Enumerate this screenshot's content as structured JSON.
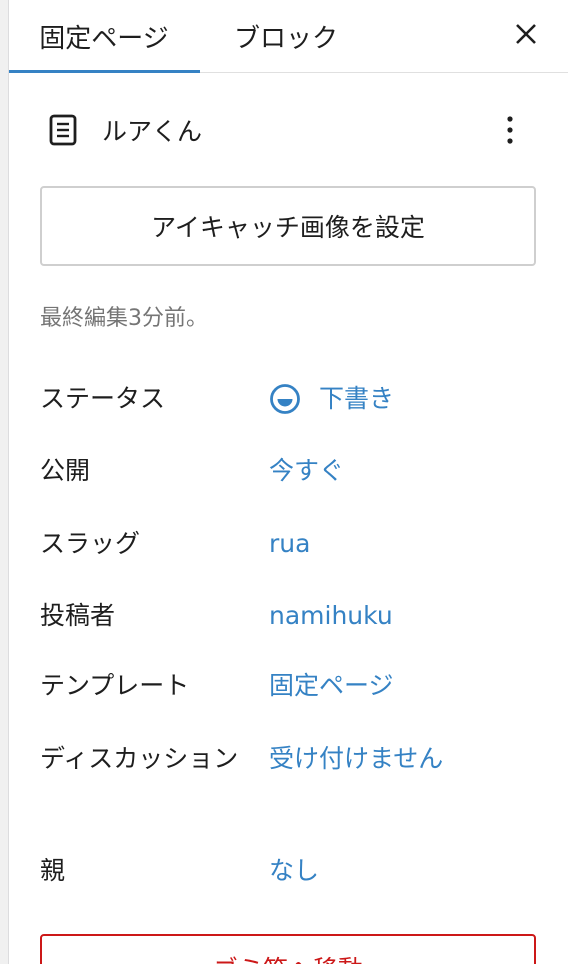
{
  "tabs": [
    {
      "label": "固定ページ",
      "active": true
    },
    {
      "label": "ブロック",
      "active": false
    }
  ],
  "icons": {
    "close": "close-icon",
    "document": "page-icon",
    "more": "more-vertical-icon",
    "status": "draft-status-icon"
  },
  "colors": {
    "accent": "#3582c4",
    "danger": "#cc1818",
    "muted": "#757575"
  },
  "page": {
    "title": "ルアくん",
    "featured_image_button": "アイキャッチ画像を設定",
    "last_edited": "最終編集3分前。"
  },
  "summary": {
    "status": {
      "label": "ステータス",
      "value": "下書き"
    },
    "publish": {
      "label": "公開",
      "value": "今すぐ"
    },
    "slug": {
      "label": "スラッグ",
      "value": "rua"
    },
    "author": {
      "label": "投稿者",
      "value": "namihuku"
    },
    "template": {
      "label": "テンプレート",
      "value": "固定ページ"
    },
    "discussion": {
      "label": "ディスカッション",
      "value": "受け付けません"
    },
    "parent": {
      "label": "親",
      "value": "なし"
    }
  },
  "trash_button": "ゴミ箱へ移動"
}
